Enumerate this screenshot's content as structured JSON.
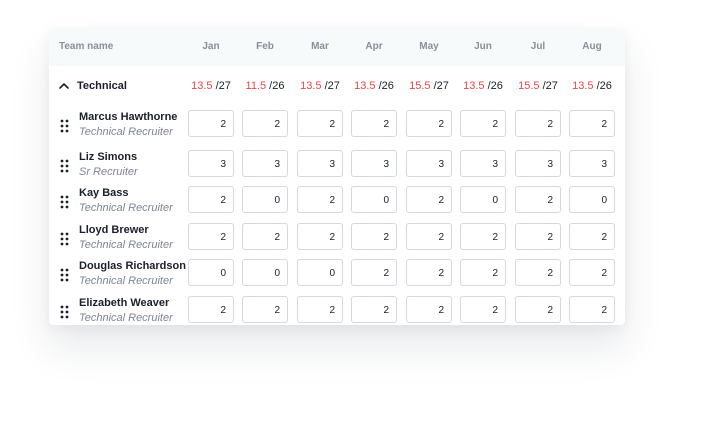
{
  "header": {
    "team_label": "Team name",
    "months": [
      "Jan",
      "Feb",
      "Mar",
      "Apr",
      "May",
      "Jun",
      "Jul",
      "Aug"
    ]
  },
  "group": {
    "name": "Technical",
    "capacity": [
      {
        "used": "13.5",
        "total": "/27"
      },
      {
        "used": "11.5",
        "total": "/26"
      },
      {
        "used": "13.5",
        "total": "/27"
      },
      {
        "used": "13.5",
        "total": "/26"
      },
      {
        "used": "15.5",
        "total": "/27"
      },
      {
        "used": "13.5",
        "total": "/26"
      },
      {
        "used": "15.5",
        "total": "/27"
      },
      {
        "used": "13.5",
        "total": "/26"
      }
    ]
  },
  "members": [
    {
      "name": "Marcus Hawthorne",
      "role": "Technical Recruiter",
      "values": [
        "2",
        "2",
        "2",
        "2",
        "2",
        "2",
        "2",
        "2"
      ]
    },
    {
      "name": "Liz Simons",
      "role": "Sr Recruiter",
      "values": [
        "3",
        "3",
        "3",
        "3",
        "3",
        "3",
        "3",
        "3"
      ]
    },
    {
      "name": "Kay Bass",
      "role": "Technical Recruiter",
      "values": [
        "2",
        "0",
        "2",
        "0",
        "2",
        "0",
        "2",
        "0"
      ]
    },
    {
      "name": "Lloyd Brewer",
      "role": "Technical Recruiter",
      "values": [
        "2",
        "2",
        "2",
        "2",
        "2",
        "2",
        "2",
        "2"
      ]
    },
    {
      "name": "Douglas Richardson",
      "role": "Technical Recruiter",
      "values": [
        "0",
        "0",
        "0",
        "2",
        "2",
        "2",
        "2",
        "2"
      ]
    },
    {
      "name": "Elizabeth Weaver",
      "role": "Technical Recruiter",
      "values": [
        "2",
        "2",
        "2",
        "2",
        "2",
        "2",
        "2",
        "2"
      ]
    }
  ],
  "icons": {
    "collapse": "chevron-up-icon",
    "drag": "drag-handle-icon"
  },
  "colors": {
    "over_capacity": "#e3474a",
    "header_bg": "#f7fafa",
    "role_text": "#7d8494"
  }
}
